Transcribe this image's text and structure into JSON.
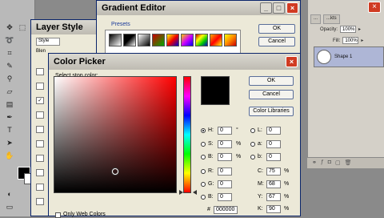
{
  "background": {
    "tabs": [
      "...",
      "...kts"
    ],
    "opacity_label": "Opacity:",
    "opacity_value": "100%",
    "fill_label": "Fill:",
    "fill_value": "100%",
    "layer_name": "Shape 1"
  },
  "layer_style": {
    "title": "Layer Style",
    "styles_label": "Style",
    "blend_label": "Blen"
  },
  "gradient_editor": {
    "title": "Gradient Editor",
    "presets_label": "Presets",
    "ok_label": "OK",
    "cancel_label": "Cancel"
  },
  "color_picker": {
    "title": "Color Picker",
    "select_label": "Select stop color:",
    "ok_label": "OK",
    "cancel_label": "Cancel",
    "libraries_label": "Color Libraries",
    "hsb": [
      {
        "label": "H:",
        "value": "0",
        "unit": "°",
        "selected": true
      },
      {
        "label": "S:",
        "value": "0",
        "unit": "%",
        "selected": false
      },
      {
        "label": "B:",
        "value": "0",
        "unit": "%",
        "selected": false
      },
      {
        "label": "R:",
        "value": "0",
        "unit": "",
        "selected": false
      },
      {
        "label": "G:",
        "value": "0",
        "unit": "",
        "selected": false
      },
      {
        "label": "B:",
        "value": "0",
        "unit": "",
        "selected": false
      }
    ],
    "lab": [
      {
        "label": "L:",
        "value": "0"
      },
      {
        "label": "a:",
        "value": "0"
      },
      {
        "label": "b:",
        "value": "0"
      }
    ],
    "cmyk": [
      {
        "label": "C:",
        "value": "75",
        "unit": "%"
      },
      {
        "label": "M:",
        "value": "68",
        "unit": "%"
      },
      {
        "label": "Y:",
        "value": "67",
        "unit": "%"
      },
      {
        "label": "K:",
        "value": "90",
        "unit": "%"
      }
    ],
    "hex_label": "#",
    "hex_value": "000000",
    "web_colors_label": "Only Web Colors"
  }
}
